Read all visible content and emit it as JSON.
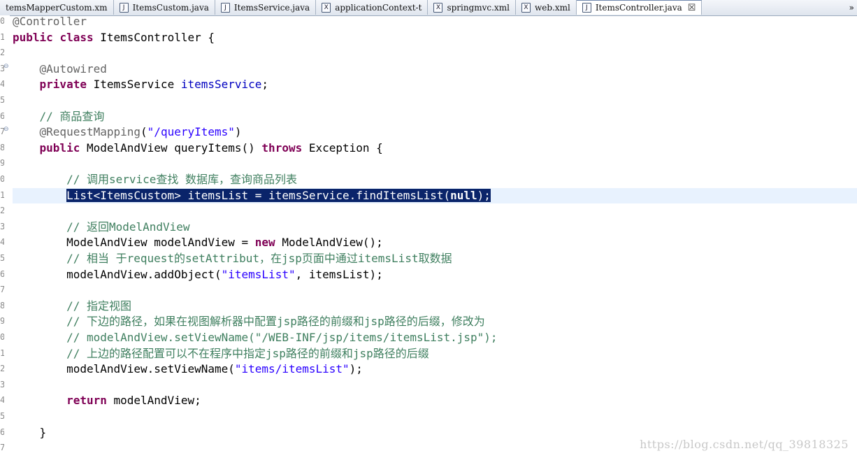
{
  "tabs": [
    {
      "label": "temsMapperCustom.xm",
      "icon": "none"
    },
    {
      "label": "ItemsCustom.java",
      "icon": "java-file-icon"
    },
    {
      "label": "ItemsService.java",
      "icon": "java-file-icon"
    },
    {
      "label": "applicationContext-t",
      "icon": "xml-file-icon"
    },
    {
      "label": "springmvc.xml",
      "icon": "xml-file-icon"
    },
    {
      "label": "web.xml",
      "icon": "xml-file-icon"
    },
    {
      "label": "ItemsController.java",
      "icon": "java-file-icon",
      "active": true
    }
  ],
  "tab_overflow": "»",
  "close_glyph": "☒",
  "file_icon_letters": {
    "java": "J",
    "xml": "X"
  },
  "line_numbers": [
    "0",
    "1",
    "2",
    "3",
    "4",
    "5",
    "6",
    "7",
    "8",
    "9",
    "0",
    "1",
    "2",
    "3",
    "4",
    "5",
    "6",
    "7",
    "8",
    "9",
    "0",
    "1",
    "2",
    "3",
    "4",
    "5",
    "6",
    "7"
  ],
  "code": {
    "l0_an": "@Controller",
    "l1_kw1": "public",
    "l1_kw2": "class",
    "l1_rest": " ItemsController {",
    "l3_an": "@Autowired",
    "l4_kw": "private",
    "l4_type": " ItemsService ",
    "l4_fld": "itemsService",
    "l4_end": ";",
    "l6_cm": "// 商品查询",
    "l7_an": "@RequestMapping",
    "l7_p1": "(",
    "l7_str": "\"/queryItems\"",
    "l7_p2": ")",
    "l8_kw1": "public",
    "l8_mid": " ModelAndView queryItems() ",
    "l8_kw2": "throws",
    "l8_end": " Exception {",
    "l10_cm": "// 调用service查找 数据库，查询商品列表",
    "l11_sel1": "List<ItemsCustom> itemsList = itemsService.findItemsList(",
    "l11_kw": "null",
    "l11_sel2": ");",
    "l13_cm": "// 返回ModelAndView",
    "l14_a": "ModelAndView modelAndView = ",
    "l14_kw": "new",
    "l14_b": " ModelAndView();",
    "l15_cm": "// 相当 于request的setAttribut，在jsp页面中通过itemsList取数据",
    "l16_a": "modelAndView.addObject(",
    "l16_str": "\"itemsList\"",
    "l16_b": ", itemsList);",
    "l18_cm": "// 指定视图",
    "l19_cm": "// 下边的路径，如果在视图解析器中配置jsp路径的前缀和jsp路径的后缀，修改为",
    "l20_cm": "// modelAndView.setViewName(\"/WEB-INF/jsp/items/itemsList.jsp\");",
    "l21_cm": "// 上边的路径配置可以不在程序中指定jsp路径的前缀和jsp路径的后缀",
    "l22_a": "modelAndView.setViewName(",
    "l22_str": "\"items/itemsList\"",
    "l22_b": ");",
    "l24_kw": "return",
    "l24_b": " modelAndView;",
    "l26": "}"
  },
  "watermark": "https://blog.csdn.net/qq_39818325",
  "colors": {
    "keyword": "#7f0055",
    "annotation": "#646464",
    "field": "#0000c0",
    "string": "#2a00ff",
    "comment": "#3f7f5f",
    "selection": "#0a246a",
    "current_line": "#e8f2fe"
  }
}
